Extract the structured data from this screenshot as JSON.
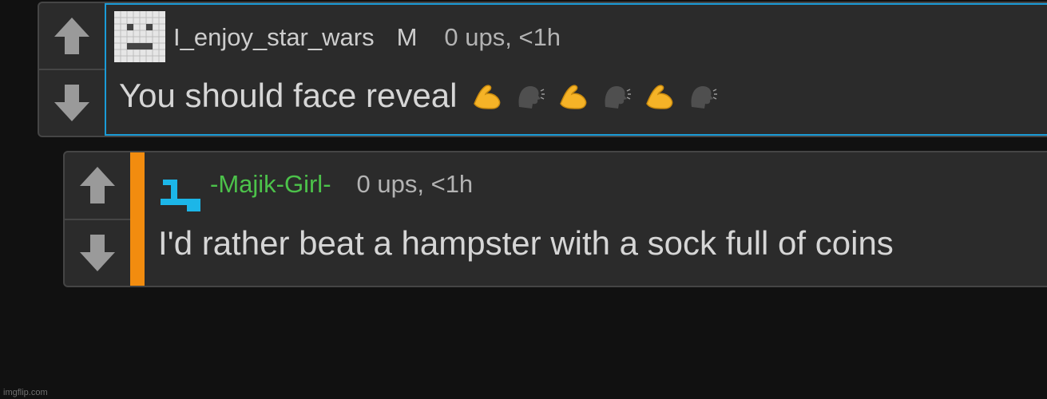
{
  "comments": [
    {
      "username": "I_enjoy_star_wars",
      "badge": "M",
      "stats": "0 ups, <1h",
      "text": "You should face reveal",
      "emoji": [
        "flexed-biceps-emoji",
        "speaking-head-emoji",
        "flexed-biceps-emoji",
        "speaking-head-emoji",
        "flexed-biceps-emoji",
        "speaking-head-emoji"
      ],
      "highlight_color": "#1a9bd7"
    },
    {
      "username": "-Majik-Girl-",
      "username_color": "#4cc24a",
      "stats": "0 ups, <1h",
      "text": "I'd rather beat a hampster with a sock full of coins",
      "reply_bar_color": "#f28c0f"
    }
  ],
  "watermark": "imgflip.com"
}
